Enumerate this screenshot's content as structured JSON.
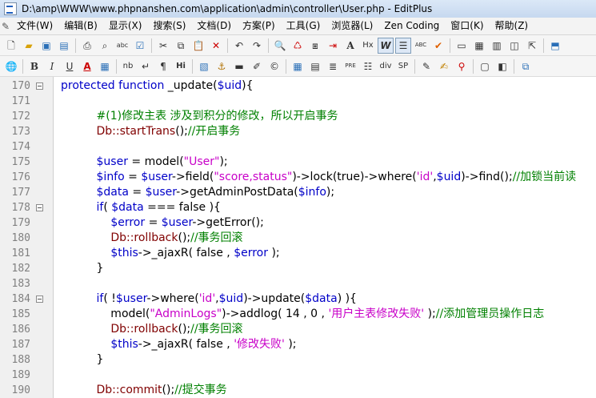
{
  "window": {
    "title": "D:\\amp\\WWW\\www.phpnanshen.com\\application\\admin\\controller\\User.php - EditPlus"
  },
  "menu": [
    "文件(W)",
    "编辑(B)",
    "显示(X)",
    "搜索(S)",
    "文档(D)",
    "方案(P)",
    "工具(G)",
    "浏览器(L)",
    "Zen Coding",
    "窗口(K)",
    "帮助(Z)"
  ],
  "toolbar_icons": {
    "row1": [
      "new-file-icon",
      "open-folder-icon",
      "save-icon",
      "save-all-icon",
      "print-icon",
      "print-preview-icon",
      "spell-check-icon",
      "check-icon",
      "cut-icon",
      "copy-icon",
      "paste-icon",
      "delete-icon",
      "undo-icon",
      "redo-icon",
      "find-icon",
      "find-replace-icon",
      "find-in-files-icon",
      "goto-line-icon",
      "font-icon",
      "hex-icon",
      "word-wrap-icon",
      "indent-guide-icon",
      "column-icon",
      "check-mark-icon",
      "fullscreen-icon",
      "browser-view-icon",
      "output-window-icon",
      "cliptext-icon",
      "open-browser-icon",
      "directory-icon"
    ],
    "row2": [
      "web-icon",
      "bold-icon",
      "italic-icon",
      "underline-icon",
      "font-color-icon",
      "color-picker-icon",
      "nbsp-icon",
      "br-icon",
      "paragraph-icon",
      "heading-icon",
      "image-icon",
      "anchor-icon",
      "hr-icon",
      "comment-icon",
      "special-char-icon",
      "table-icon",
      "form-icon",
      "center-icon",
      "pre-icon",
      "list-icon",
      "div-icon",
      "span-icon",
      "edit-icon",
      "brush-icon",
      "fork-icon",
      "frame-icon",
      "template-icon",
      "html-tools-icon"
    ]
  },
  "toolbar_text": {
    "nb": "nb",
    "Hi": "Hi",
    "PRE": "PRE",
    "div": "div",
    "SP": "SP",
    "Hx": "Hx"
  },
  "code_lines": [
    {
      "num": "170",
      "fold": true,
      "html": "<span class='c-kw'>protected function</span> _update(<span class='c-var'>$uid</span>){"
    },
    {
      "num": "171",
      "fold": false,
      "html": ""
    },
    {
      "num": "172",
      "fold": false,
      "html": "&nbsp;&nbsp;&nbsp;&nbsp;&nbsp;&nbsp;&nbsp;&nbsp;&nbsp;&nbsp;<span class='c-cmt'>#(1)修改主表 涉及到积分的修改，所以开启事务</span>"
    },
    {
      "num": "173",
      "fold": false,
      "html": "&nbsp;&nbsp;&nbsp;&nbsp;&nbsp;&nbsp;&nbsp;&nbsp;&nbsp;&nbsp;<span class='c-cls'>Db::startTrans</span>();<span class='c-cmt'>//开启事务</span>"
    },
    {
      "num": "174",
      "fold": false,
      "html": ""
    },
    {
      "num": "175",
      "fold": false,
      "html": "&nbsp;&nbsp;&nbsp;&nbsp;&nbsp;&nbsp;&nbsp;&nbsp;&nbsp;&nbsp;<span class='c-var'>$user</span> = model(<span class='c-str'>\"User\"</span>);"
    },
    {
      "num": "176",
      "fold": false,
      "html": "&nbsp;&nbsp;&nbsp;&nbsp;&nbsp;&nbsp;&nbsp;&nbsp;&nbsp;&nbsp;<span class='c-var'>$info</span> = <span class='c-var'>$user</span>->field(<span class='c-str'>\"score,status\"</span>)->lock(true)->where(<span class='c-str'>'id'</span>,<span class='c-var'>$uid</span>)->find();<span class='c-cmt'>//加锁当前读</span>"
    },
    {
      "num": "177",
      "fold": false,
      "html": "&nbsp;&nbsp;&nbsp;&nbsp;&nbsp;&nbsp;&nbsp;&nbsp;&nbsp;&nbsp;<span class='c-var'>$data</span> = <span class='c-var'>$user</span>->getAdminPostData(<span class='c-var'>$info</span>);"
    },
    {
      "num": "178",
      "fold": true,
      "html": "&nbsp;&nbsp;&nbsp;&nbsp;&nbsp;&nbsp;&nbsp;&nbsp;&nbsp;&nbsp;<span class='c-kw'>if</span>( <span class='c-var'>$data</span> === false ){"
    },
    {
      "num": "179",
      "fold": false,
      "html": "&nbsp;&nbsp;&nbsp;&nbsp;&nbsp;&nbsp;&nbsp;&nbsp;&nbsp;&nbsp;&nbsp;&nbsp;&nbsp;&nbsp;<span class='c-var'>$error</span> = <span class='c-var'>$user</span>->getError();"
    },
    {
      "num": "180",
      "fold": false,
      "html": "&nbsp;&nbsp;&nbsp;&nbsp;&nbsp;&nbsp;&nbsp;&nbsp;&nbsp;&nbsp;&nbsp;&nbsp;&nbsp;&nbsp;<span class='c-cls'>Db::rollback</span>();<span class='c-cmt'>//事务回滚</span>"
    },
    {
      "num": "181",
      "fold": false,
      "html": "&nbsp;&nbsp;&nbsp;&nbsp;&nbsp;&nbsp;&nbsp;&nbsp;&nbsp;&nbsp;&nbsp;&nbsp;&nbsp;&nbsp;<span class='c-var'>$this</span>->_ajaxR( false , <span class='c-var'>$error</span> );"
    },
    {
      "num": "182",
      "fold": false,
      "html": "&nbsp;&nbsp;&nbsp;&nbsp;&nbsp;&nbsp;&nbsp;&nbsp;&nbsp;&nbsp;}"
    },
    {
      "num": "183",
      "fold": false,
      "html": ""
    },
    {
      "num": "184",
      "fold": true,
      "html": "&nbsp;&nbsp;&nbsp;&nbsp;&nbsp;&nbsp;&nbsp;&nbsp;&nbsp;&nbsp;<span class='c-kw'>if</span>( !<span class='c-var'>$user</span>->where(<span class='c-str'>'id'</span>,<span class='c-var'>$uid</span>)->update(<span class='c-var'>$data</span>) ){"
    },
    {
      "num": "185",
      "fold": false,
      "html": "&nbsp;&nbsp;&nbsp;&nbsp;&nbsp;&nbsp;&nbsp;&nbsp;&nbsp;&nbsp;&nbsp;&nbsp;&nbsp;&nbsp;model(<span class='c-str'>\"AdminLogs\"</span>)->addlog( 14 , 0 , <span class='c-str'>'用户主表修改失败'</span> );<span class='c-cmt'>//添加管理员操作日志</span>"
    },
    {
      "num": "186",
      "fold": false,
      "html": "&nbsp;&nbsp;&nbsp;&nbsp;&nbsp;&nbsp;&nbsp;&nbsp;&nbsp;&nbsp;&nbsp;&nbsp;&nbsp;&nbsp;<span class='c-cls'>Db::rollback</span>();<span class='c-cmt'>//事务回滚</span>"
    },
    {
      "num": "187",
      "fold": false,
      "html": "&nbsp;&nbsp;&nbsp;&nbsp;&nbsp;&nbsp;&nbsp;&nbsp;&nbsp;&nbsp;&nbsp;&nbsp;&nbsp;&nbsp;<span class='c-var'>$this</span>->_ajaxR( false , <span class='c-str'>'修改失败'</span> );"
    },
    {
      "num": "188",
      "fold": false,
      "html": "&nbsp;&nbsp;&nbsp;&nbsp;&nbsp;&nbsp;&nbsp;&nbsp;&nbsp;&nbsp;}"
    },
    {
      "num": "189",
      "fold": false,
      "html": ""
    },
    {
      "num": "190",
      "fold": false,
      "html": "&nbsp;&nbsp;&nbsp;&nbsp;&nbsp;&nbsp;&nbsp;&nbsp;&nbsp;&nbsp;<span class='c-cls'>Db::commit</span>();<span class='c-cmt'>//提交事务</span>"
    }
  ]
}
